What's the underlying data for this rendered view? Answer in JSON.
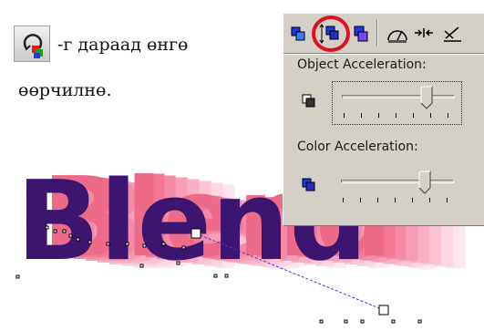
{
  "instruction": {
    "line1": "-г дараад өнгө",
    "line2": "өөрчилнө."
  },
  "art": {
    "word": "Blend",
    "colors": {
      "text": "#3b1570",
      "shadow_near": "#f48aa6",
      "shadow_far": "#fde7ef",
      "guide": "#3b3bd6"
    }
  },
  "panel": {
    "toolbar_icons": [
      "object-acceleration-icon",
      "steps-acceleration-icon",
      "color-blend-icon",
      "path-properties-icon",
      "fuse-icon",
      "misc-options-icon"
    ],
    "object_acceleration": {
      "label": "Object Acceleration:",
      "position": 0.74
    },
    "color_acceleration": {
      "label": "Color Acceleration:",
      "position": 0.73
    },
    "colors": {
      "panel_bg": "#d4d0c8",
      "highlight": "#e0101e"
    }
  }
}
